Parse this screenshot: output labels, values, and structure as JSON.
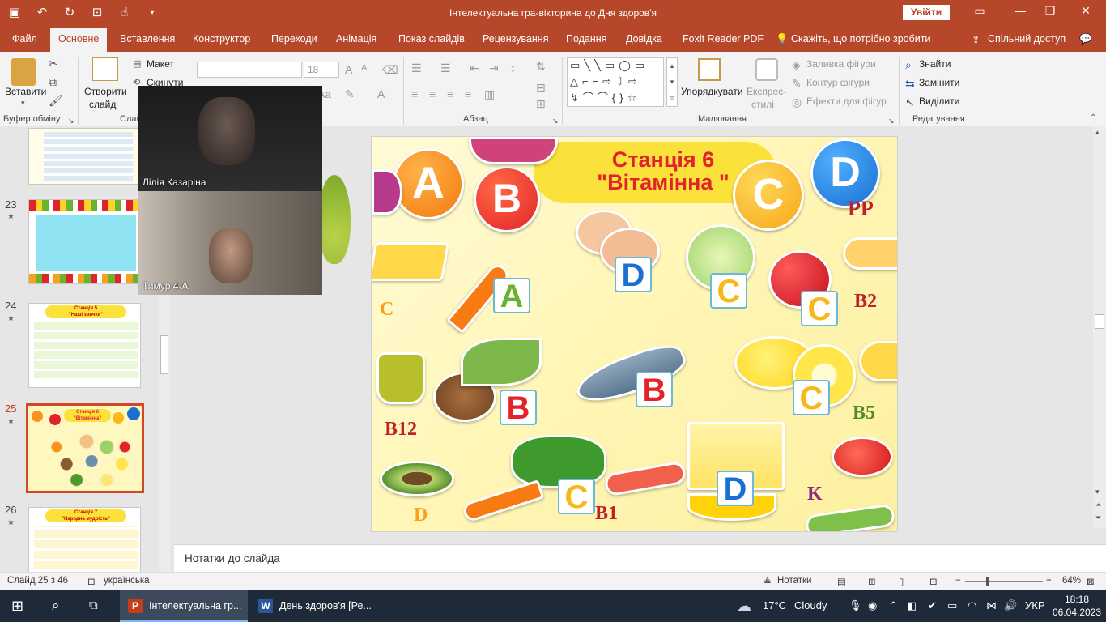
{
  "title_bar": {
    "doc_title": "Інтелектуальна гра-вікторина до Дня здоров'я",
    "sign_in": "Увійти",
    "quick_access_icons": [
      "save-icon",
      "undo-icon",
      "redo-icon",
      "presenter-icon",
      "touch-icon",
      "more-icon"
    ]
  },
  "tabs": [
    "Файл",
    "Основне",
    "Вставлення",
    "Конструктор",
    "Переходи",
    "Анімація",
    "Показ слайдів",
    "Рецензування",
    "Подання",
    "Довідка",
    "Foxit Reader PDF"
  ],
  "tell_me": "Скажіть, що потрібно зробити",
  "share": "Спільний доступ",
  "ribbon": {
    "paste": "Вставити",
    "clipboard_group": "Буфер обміну",
    "new_slide": "Створити",
    "new_slide_2": "слайд",
    "layout": "Макет",
    "reset": "Скинути",
    "slides_group": "Слайди",
    "font_size": "18",
    "paragraph_group": "Абзац",
    "arrange": "Упорядкувати",
    "quick_styles": "Експрес-",
    "quick_styles_2": "стилі",
    "shape_fill": "Заливка фігури",
    "shape_outline": "Контур фігури",
    "shape_effects": "Ефекти для фігур",
    "drawing_group": "Малювання",
    "find": "Знайти",
    "replace": "Замінити",
    "select": "Виділити",
    "editing_group": "Редагування"
  },
  "thumbnails": [
    {
      "num": "23"
    },
    {
      "num": "24",
      "title": "Станція 5",
      "subtitle": "\"Наші звички\""
    },
    {
      "num": "25",
      "title": "Станція 6",
      "subtitle": "\"Вітамінна\""
    },
    {
      "num": "26",
      "title": "Станція 7",
      "subtitle": "\"Народна мудрість\""
    }
  ],
  "video": {
    "participant_1": "Лілія Казаріна",
    "participant_2": "Тимур 4-А"
  },
  "slide": {
    "title_line1": "Станція 6",
    "title_line2": "\"Вітамінна \"",
    "balls": [
      "A",
      "B",
      "C",
      "D"
    ],
    "label_boxes": [
      "A",
      "D",
      "C",
      "C",
      "B",
      "B",
      "C",
      "C",
      "D"
    ],
    "floating_letters": [
      "PP",
      "C",
      "B2",
      "B12",
      "B5",
      "D",
      "B1",
      "K"
    ]
  },
  "notes_placeholder": "Нотатки до слайда",
  "status": {
    "slide_info": "Слайд 25 з 46",
    "language": "українська",
    "notes_btn": "Нотатки",
    "zoom": "64%"
  },
  "taskbar": {
    "app1": "Інтелектуальна гр...",
    "app2": "День здоров'я [Ре...",
    "weather_temp": "17°C",
    "weather_desc": "Cloudy",
    "keyboard": "УКР",
    "time": "18:18",
    "date": "06.04.2023"
  },
  "colors": {
    "accent": "#b7472a",
    "vitamin_red": "#e3232b",
    "vitamin_blue": "#1a6fd0",
    "vitamin_yellow": "#f7b81a",
    "vitamin_green": "#6ab42d"
  }
}
